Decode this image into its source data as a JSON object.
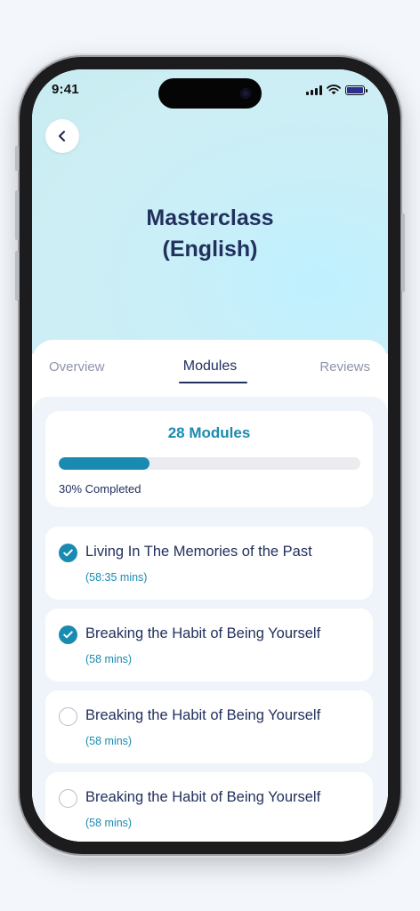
{
  "status": {
    "time": "9:41"
  },
  "header": {
    "title": "Masterclass\n(English)"
  },
  "tabs": [
    {
      "label": "Overview"
    },
    {
      "label": "Modules",
      "active": true
    },
    {
      "label": "Reviews"
    }
  ],
  "progress": {
    "count_label": "28 Modules",
    "percent": 30,
    "completed_label": "30% Completed"
  },
  "modules": [
    {
      "title": "Living In The Memories of the Past",
      "duration": "(58:35 mins)",
      "completed": true
    },
    {
      "title": "Breaking the Habit of Being Yourself",
      "duration": "(58 mins)",
      "completed": true
    },
    {
      "title": "Breaking the Habit of Being Yourself",
      "duration": "(58 mins)",
      "completed": false
    },
    {
      "title": "Breaking the Habit of Being Yourself",
      "duration": "(58 mins)",
      "completed": false
    }
  ],
  "colors": {
    "accent": "#1a8bb0",
    "navy": "#22305e",
    "muted": "#8e94aa"
  },
  "icons": {
    "back": "chevron-left-icon",
    "check": "check-icon",
    "unchecked": "empty-circle-icon"
  }
}
